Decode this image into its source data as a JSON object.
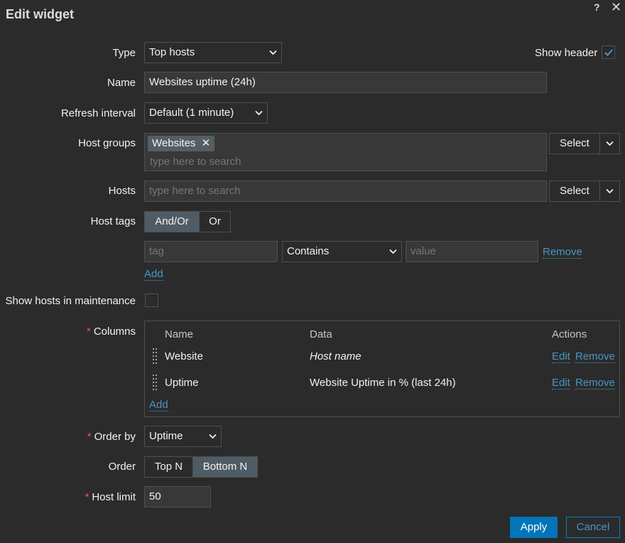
{
  "dialog": {
    "title": "Edit widget",
    "help": "?",
    "close": "✕"
  },
  "form": {
    "type": {
      "label": "Type",
      "value": "Top hosts"
    },
    "show_header": {
      "label": "Show header",
      "checked": true
    },
    "name": {
      "label": "Name",
      "value": "Websites uptime (24h)"
    },
    "refresh": {
      "label": "Refresh interval",
      "value": "Default (1 minute)"
    },
    "host_groups": {
      "label": "Host groups",
      "chips": [
        "Websites"
      ],
      "placeholder": "type here to search",
      "select_label": "Select"
    },
    "hosts": {
      "label": "Hosts",
      "placeholder": "type here to search",
      "select_label": "Select"
    },
    "host_tags": {
      "label": "Host tags",
      "options": [
        "And/Or",
        "Or"
      ],
      "selected": "And/Or",
      "tag_placeholder": "tag",
      "operator": "Contains",
      "value_placeholder": "value",
      "remove_label": "Remove",
      "add_label": "Add"
    },
    "maintenance": {
      "label": "Show hosts in maintenance",
      "checked": false
    },
    "columns": {
      "required": "*",
      "label": "Columns",
      "headers": [
        "Name",
        "Data",
        "Actions"
      ],
      "rows": [
        {
          "name": "Website",
          "data": "Host name",
          "italic": true,
          "edit": "Edit",
          "remove": "Remove"
        },
        {
          "name": "Uptime",
          "data": "Website Uptime in % (last 24h)",
          "italic": false,
          "edit": "Edit",
          "remove": "Remove"
        }
      ],
      "add_label": "Add"
    },
    "order_by": {
      "required": "*",
      "label": "Order by",
      "value": "Uptime"
    },
    "order": {
      "label": "Order",
      "options": [
        "Top N",
        "Bottom N"
      ],
      "selected": "Bottom N"
    },
    "host_limit": {
      "required": "*",
      "label": "Host limit",
      "value": "50"
    }
  },
  "footer": {
    "apply": "Apply",
    "cancel": "Cancel"
  },
  "colors": {
    "background": "#2b2b2b",
    "input_bg": "#383838",
    "border": "#4f4f4f",
    "accent": "#0275b8",
    "link": "#4796c4",
    "required": "#e45959",
    "segment_active": "#4f5c66",
    "chip": "#555e64"
  }
}
